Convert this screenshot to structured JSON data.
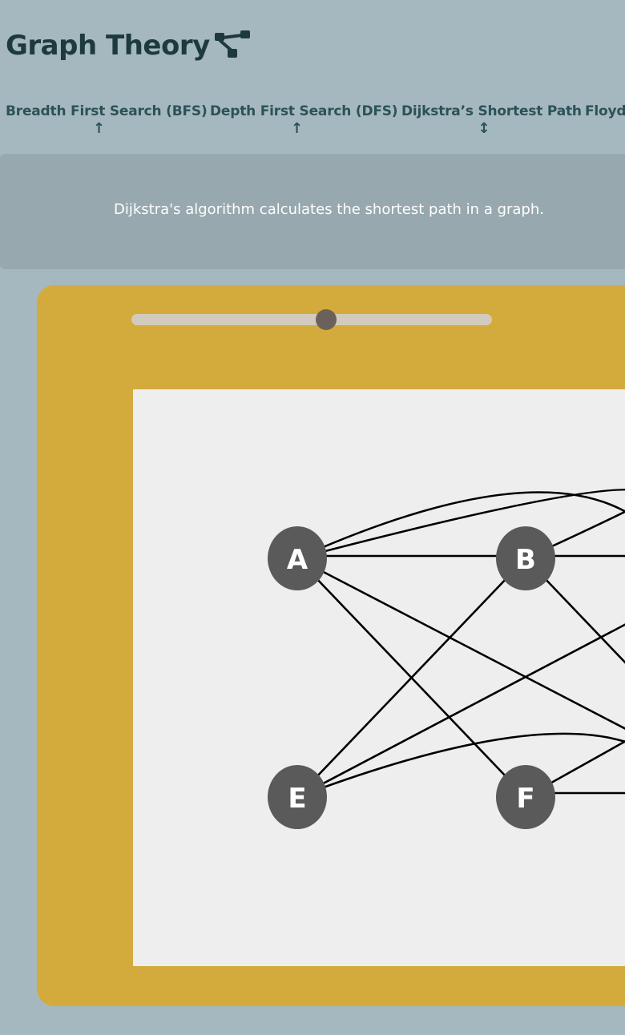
{
  "app": {
    "title": "Graph Theory",
    "logo_icon": "graph-nodes-icon"
  },
  "nav": {
    "tabs": [
      {
        "label": "Breadth First Search (BFS)",
        "arrow": "↑"
      },
      {
        "label": "Depth First Search (DFS)",
        "arrow": "↑"
      },
      {
        "label": "Dijkstra’s Shortest Path",
        "arrow": "↕"
      },
      {
        "label": "Floyd-",
        "arrow": ""
      }
    ]
  },
  "description": {
    "text": "Dijkstra's algorithm calculates the shortest path in a graph."
  },
  "speed_slider": {
    "value": 0.54
  },
  "graph": {
    "nodes": [
      {
        "id": "A",
        "label": "A"
      },
      {
        "id": "B",
        "label": "B"
      },
      {
        "id": "E",
        "label": "E"
      },
      {
        "id": "F",
        "label": "F"
      }
    ]
  },
  "colors": {
    "background": "#a6b8bf",
    "title": "#1d3a3f",
    "nav_text": "#2b5258",
    "description_panel": "#97a8ae",
    "visualizer_frame": "#d3ab3c",
    "canvas": "#eeeeee",
    "node_fill": "#5a5a5a",
    "node_text": "#ffffff",
    "edge": "#000000",
    "slider_track": "#d2cbbd",
    "slider_thumb": "#6a625a"
  }
}
